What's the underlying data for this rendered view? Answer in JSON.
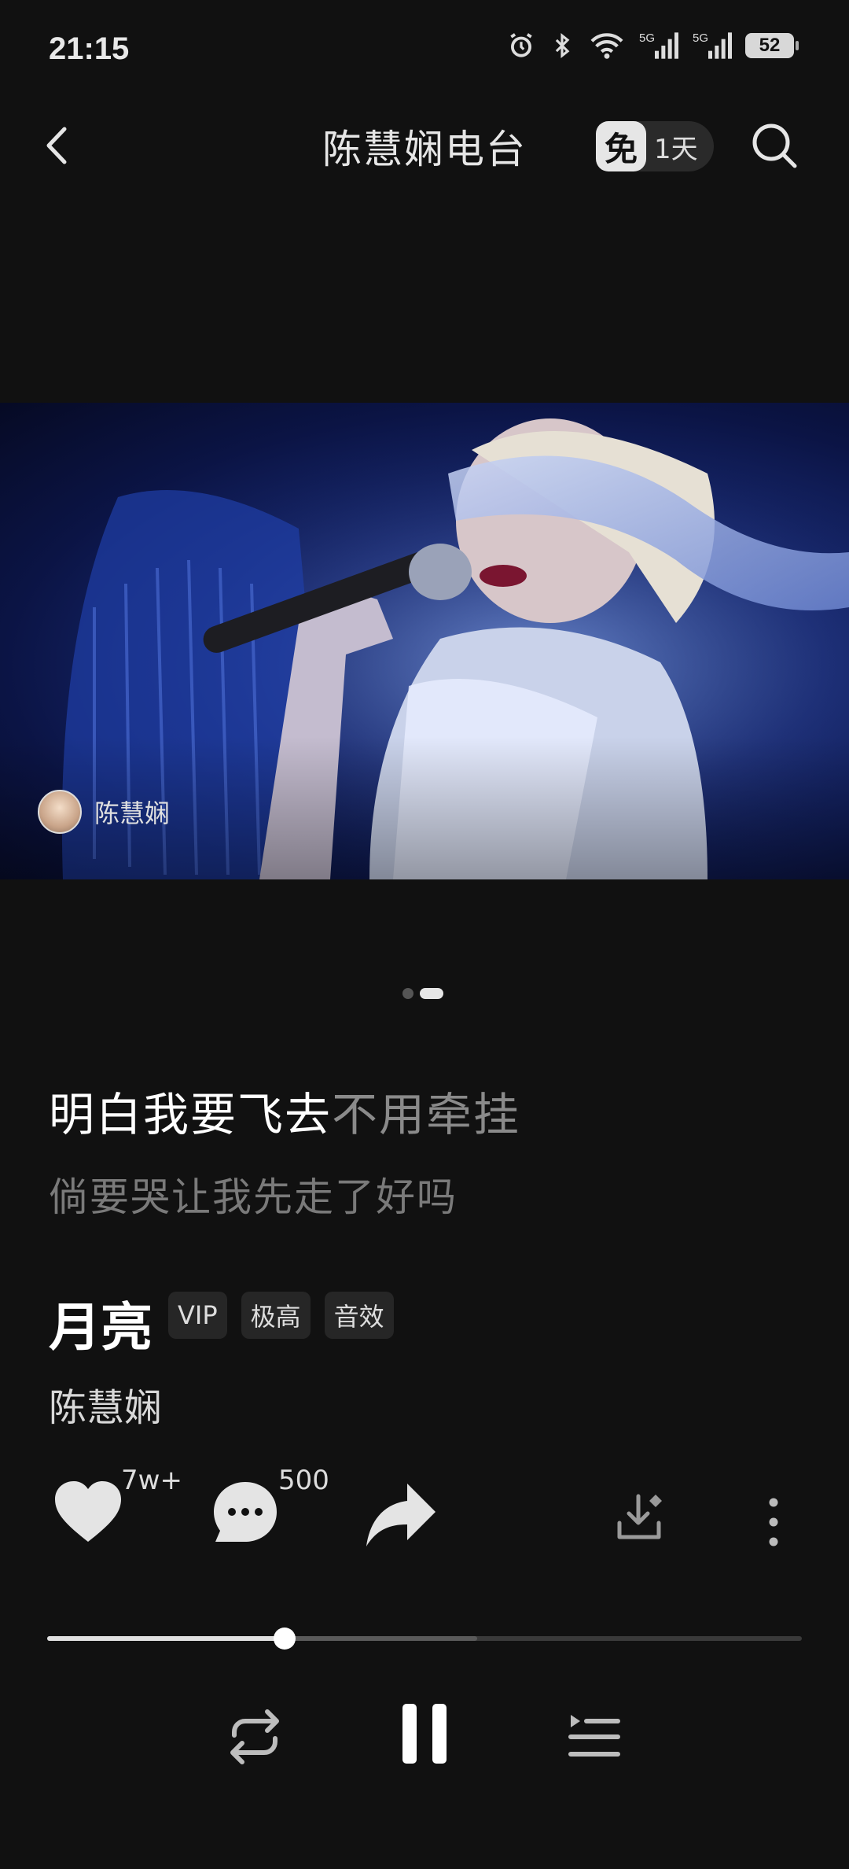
{
  "status_bar": {
    "time": "21:15",
    "battery": "52"
  },
  "header": {
    "title": "陈慧娴电台",
    "free_badge": "免",
    "free_days": "1天"
  },
  "video": {
    "credit_name": "陈慧娴"
  },
  "lyrics": {
    "current_sung": "明白我要飞去",
    "current_unsung": "不用牵挂",
    "next": "倘要哭让我先走了好吗"
  },
  "song": {
    "title": "月亮",
    "tags": [
      "VIP",
      "极高",
      "音效"
    ],
    "artist": "陈慧娴"
  },
  "actions": {
    "like_count": "7w+",
    "comment_count": "500"
  },
  "playback": {
    "progress": 0.315,
    "buffered": 0.57,
    "state": "playing"
  },
  "pager": {
    "total": 2,
    "active": 2
  },
  "icons": [
    "back-icon",
    "search-icon",
    "heart-icon",
    "comment-icon",
    "share-icon",
    "download-icon",
    "more-icon",
    "repeat-icon",
    "pause-icon",
    "playlist-icon"
  ]
}
